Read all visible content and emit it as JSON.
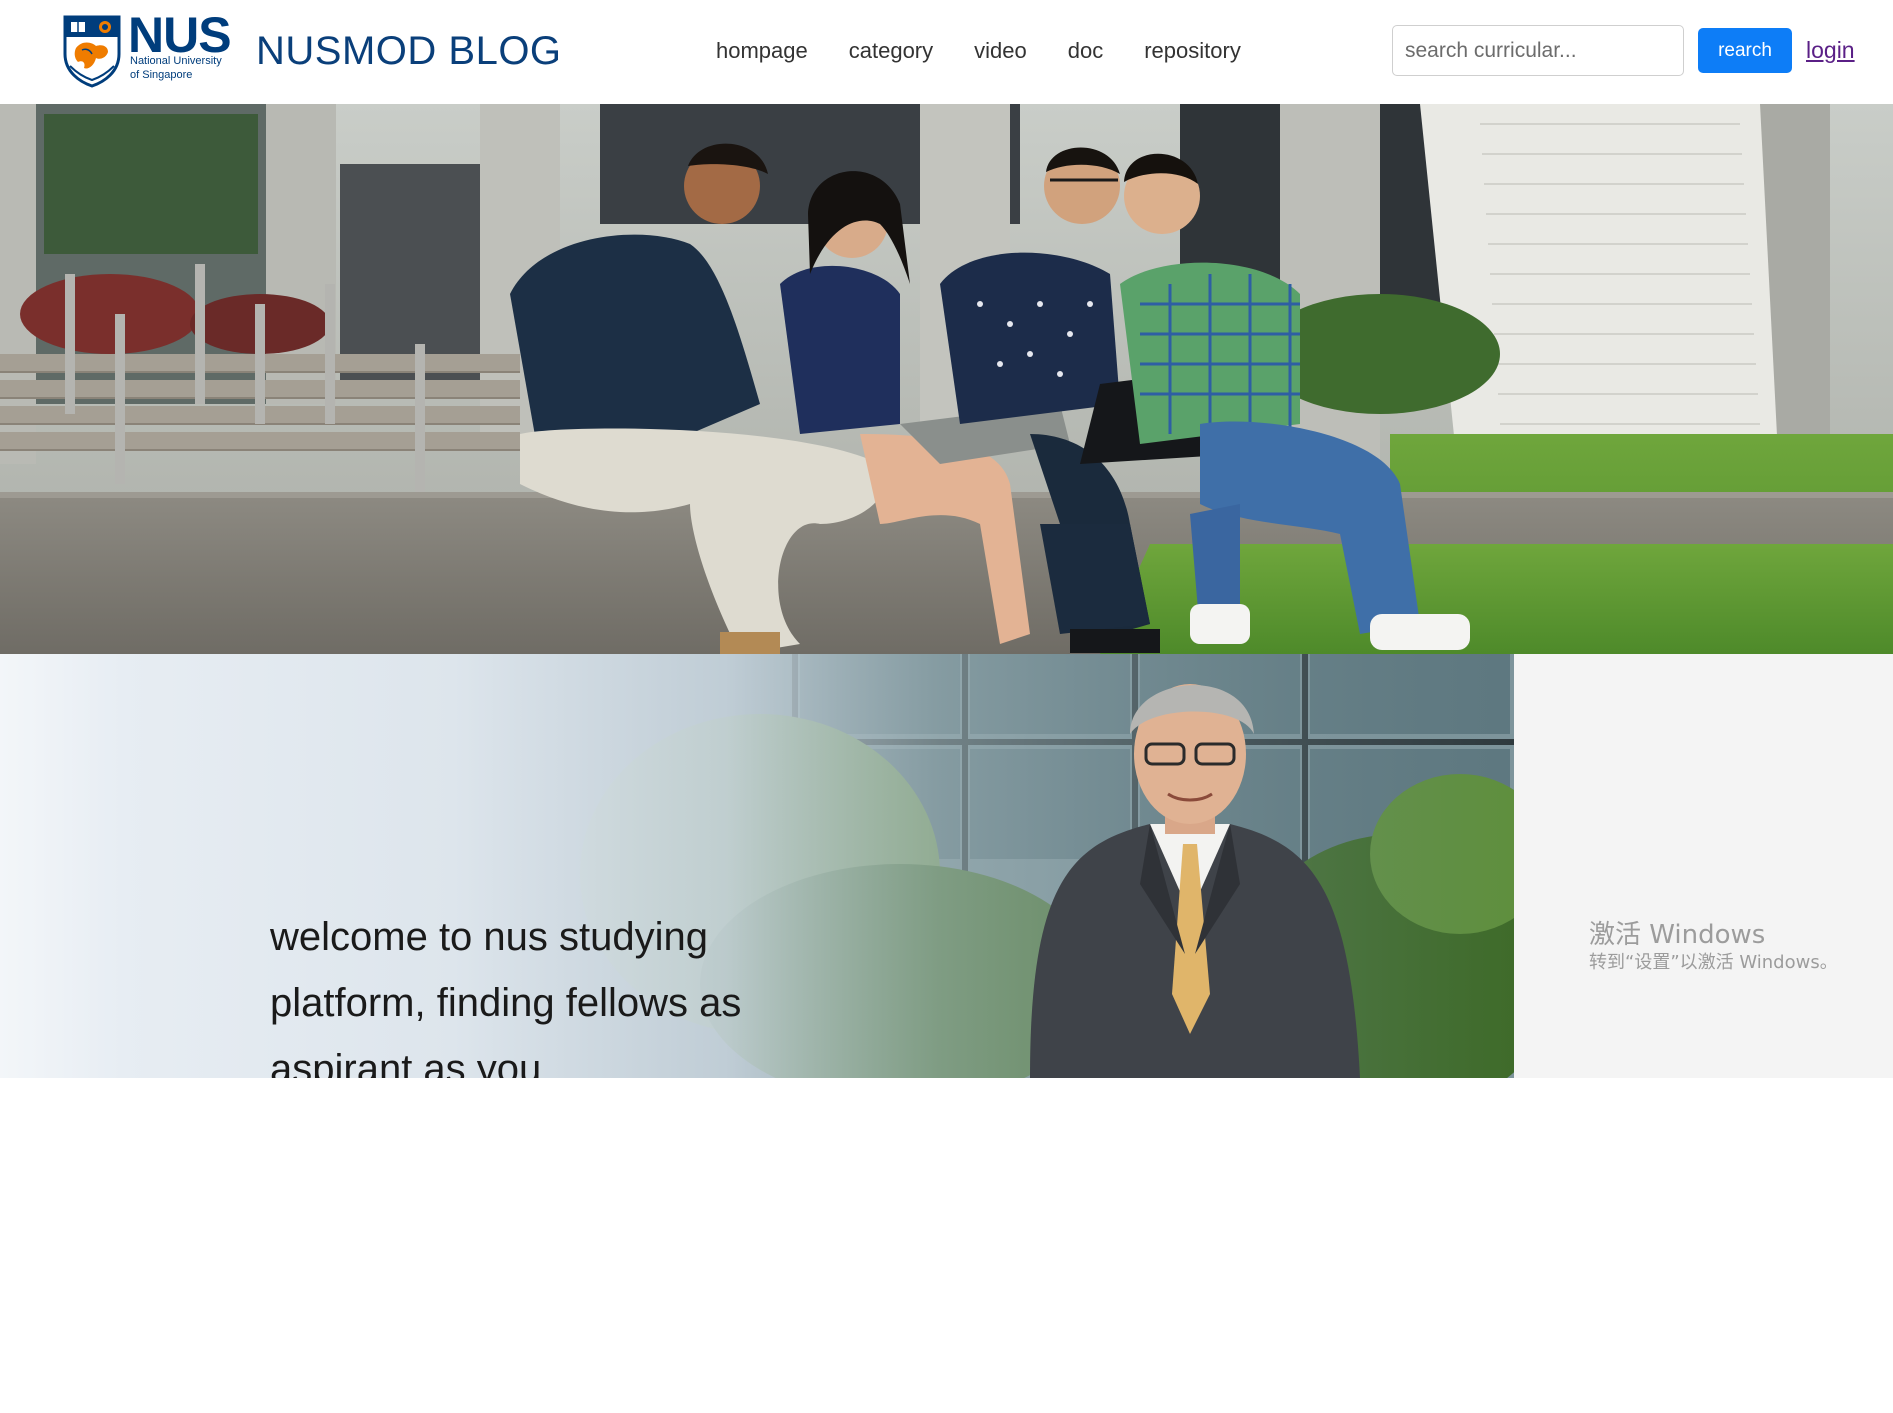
{
  "logo": {
    "wordmark": "NUS",
    "subtitle_line1": "National University",
    "subtitle_line2": "of Singapore"
  },
  "header": {
    "site_title": "NUSMOD BLOG",
    "nav": [
      {
        "label": "hompage"
      },
      {
        "label": "category"
      },
      {
        "label": "video"
      },
      {
        "label": "doc"
      },
      {
        "label": "repository"
      }
    ],
    "search": {
      "placeholder": "search curricular...",
      "value": "",
      "button_label": "rearch"
    },
    "login_label": "login"
  },
  "banner": {
    "welcome_text": "welcome to nus studying platform, finding fellows as aspirant as you"
  },
  "os_watermark": {
    "title": "激活 Windows",
    "subtitle": "转到“设置”以激活 Windows。"
  },
  "colors": {
    "brand_blue": "#003d7c",
    "brand_orange": "#ef7c00",
    "button_blue": "#0d7df7",
    "login_link": "#5a1f86"
  }
}
